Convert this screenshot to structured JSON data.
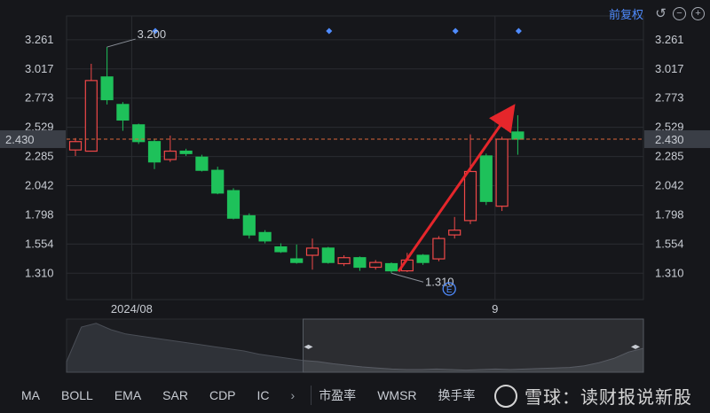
{
  "header": {
    "adjust_label": "前复权"
  },
  "icons": {
    "undo": "undo-icon",
    "zoom_out": "zoom-out-icon",
    "zoom_in": "zoom-in-icon"
  },
  "colors": {
    "up": "#f04848",
    "down": "#1ec15a",
    "bg": "#16171b",
    "grid": "#2a2c31",
    "price_line": "#d9643a",
    "accent": "#4f8cff"
  },
  "chart_data": {
    "type": "candlestick",
    "y_ticks": [
      "3.261",
      "3.017",
      "2.773",
      "2.529",
      "2.285",
      "2.042",
      "1.798",
      "1.554",
      "1.310"
    ],
    "ylim": [
      1.09,
      3.43
    ],
    "x_labels": [
      {
        "index": 3,
        "label": "2024/08"
      },
      {
        "index": 26,
        "label": "9"
      }
    ],
    "current_price": {
      "value": 2.43,
      "label": "2.430"
    },
    "annotations": [
      {
        "index": 2,
        "value": 3.2,
        "label": "3.200"
      },
      {
        "index": 20,
        "value": 1.31,
        "label": "1.310"
      }
    ],
    "event_markers": [
      5,
      16,
      24,
      28
    ],
    "dividend_marker": {
      "index": 24,
      "label": "E"
    },
    "candles": [
      {
        "o": 2.34,
        "c": 2.41,
        "h": 2.44,
        "l": 2.29
      },
      {
        "o": 2.33,
        "c": 2.92,
        "h": 3.06,
        "l": 2.33
      },
      {
        "o": 2.95,
        "c": 2.76,
        "h": 3.2,
        "l": 2.72
      },
      {
        "o": 2.72,
        "c": 2.59,
        "h": 2.74,
        "l": 2.5
      },
      {
        "o": 2.55,
        "c": 2.41,
        "h": 2.56,
        "l": 2.39
      },
      {
        "o": 2.41,
        "c": 2.24,
        "h": 2.43,
        "l": 2.18
      },
      {
        "o": 2.26,
        "c": 2.33,
        "h": 2.46,
        "l": 2.24
      },
      {
        "o": 2.33,
        "c": 2.31,
        "h": 2.35,
        "l": 2.29
      },
      {
        "o": 2.28,
        "c": 2.17,
        "h": 2.3,
        "l": 2.16
      },
      {
        "o": 2.17,
        "c": 1.98,
        "h": 2.2,
        "l": 1.97
      },
      {
        "o": 2.0,
        "c": 1.77,
        "h": 2.02,
        "l": 1.76
      },
      {
        "o": 1.79,
        "c": 1.63,
        "h": 1.81,
        "l": 1.6
      },
      {
        "o": 1.65,
        "c": 1.58,
        "h": 1.67,
        "l": 1.56
      },
      {
        "o": 1.53,
        "c": 1.49,
        "h": 1.56,
        "l": 1.48
      },
      {
        "o": 1.43,
        "c": 1.4,
        "h": 1.55,
        "l": 1.39
      },
      {
        "o": 1.46,
        "c": 1.52,
        "h": 1.6,
        "l": 1.34
      },
      {
        "o": 1.52,
        "c": 1.4,
        "h": 1.53,
        "l": 1.39
      },
      {
        "o": 1.39,
        "c": 1.44,
        "h": 1.46,
        "l": 1.37
      },
      {
        "o": 1.44,
        "c": 1.36,
        "h": 1.45,
        "l": 1.33
      },
      {
        "o": 1.36,
        "c": 1.4,
        "h": 1.42,
        "l": 1.34
      },
      {
        "o": 1.39,
        "c": 1.33,
        "h": 1.4,
        "l": 1.31
      },
      {
        "o": 1.33,
        "c": 1.42,
        "h": 1.48,
        "l": 1.32
      },
      {
        "o": 1.46,
        "c": 1.4,
        "h": 1.47,
        "l": 1.38
      },
      {
        "o": 1.43,
        "c": 1.6,
        "h": 1.62,
        "l": 1.41
      },
      {
        "o": 1.63,
        "c": 1.67,
        "h": 1.78,
        "l": 1.6
      },
      {
        "o": 1.75,
        "c": 2.16,
        "h": 2.47,
        "l": 1.72
      },
      {
        "o": 2.29,
        "c": 1.91,
        "h": 2.31,
        "l": 1.88
      },
      {
        "o": 1.87,
        "c": 2.43,
        "h": 2.45,
        "l": 1.83
      },
      {
        "o": 2.49,
        "c": 2.43,
        "h": 2.63,
        "l": 2.3
      }
    ],
    "trend_arrow": {
      "from": {
        "index": 20,
        "value": 1.34
      },
      "to": {
        "index": 28,
        "value": 2.67
      }
    }
  },
  "navigator": {
    "profile": [
      0.2,
      0.85,
      0.92,
      0.8,
      0.72,
      0.68,
      0.64,
      0.6,
      0.56,
      0.52,
      0.48,
      0.44,
      0.4,
      0.34,
      0.3,
      0.26,
      0.22,
      0.2,
      0.16,
      0.13,
      0.1,
      0.08,
      0.06,
      0.05,
      0.05,
      0.06,
      0.05,
      0.04,
      0.05,
      0.06,
      0.05,
      0.06,
      0.07,
      0.08,
      0.09,
      0.12,
      0.18,
      0.26,
      0.38,
      0.45
    ],
    "window": [
      0.41,
      1.0
    ]
  },
  "tabs": [
    "MA",
    "BOLL",
    "EMA",
    "SAR",
    "CDP",
    "IC",
    "市盈率",
    "WMSR",
    "换手率"
  ],
  "watermark": "雪球：读财报说新股"
}
